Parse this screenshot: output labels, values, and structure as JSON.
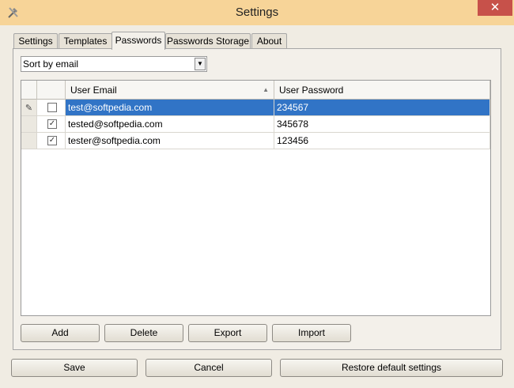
{
  "window": {
    "title": "Settings",
    "close": "✕"
  },
  "tabs": [
    {
      "label": "Settings"
    },
    {
      "label": "Templates"
    },
    {
      "label": "Passwords"
    },
    {
      "label": "Passwords Storage"
    },
    {
      "label": "About"
    }
  ],
  "sort": {
    "selected": "Sort by email"
  },
  "grid": {
    "columns": [
      "User Email",
      "User Password"
    ],
    "rows": [
      {
        "email": "test@softpedia.com",
        "password": "234567",
        "checked": false,
        "selected": true
      },
      {
        "email": "tested@softpedia.com",
        "password": "345678",
        "checked": true,
        "selected": false
      },
      {
        "email": "tester@softpedia.com",
        "password": "123456",
        "checked": true,
        "selected": false
      }
    ]
  },
  "actions": {
    "add": "Add",
    "delete": "Delete",
    "export": "Export",
    "import": "Import"
  },
  "footer": {
    "save": "Save",
    "cancel": "Cancel",
    "restore": "Restore default settings"
  },
  "colors": {
    "titlebar": "#f7d498",
    "selection": "#3174c6",
    "close": "#c7514a"
  }
}
